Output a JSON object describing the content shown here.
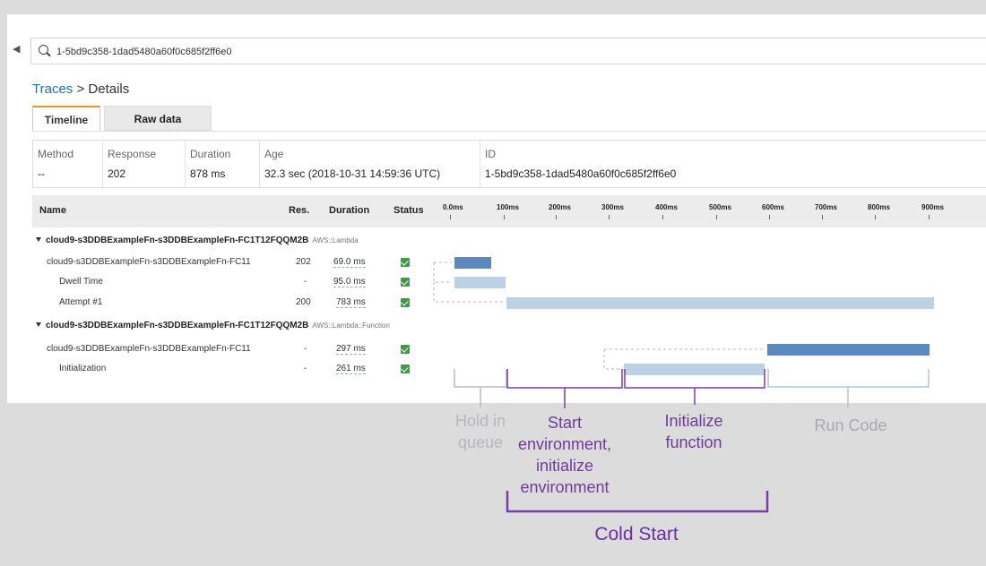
{
  "search": {
    "value": "1-5bd9c358-1dad5480a60f0c685f2ff6e0"
  },
  "breadcrumb": {
    "link": "Traces",
    "separator": ">",
    "current": "Details"
  },
  "tabs": [
    {
      "label": "Timeline",
      "active": true
    },
    {
      "label": "Raw data",
      "active": false
    }
  ],
  "summary": {
    "headers": [
      "Method",
      "Response",
      "Duration",
      "Age",
      "ID"
    ],
    "values": [
      "--",
      "202",
      "878 ms",
      "32.3 sec (2018-10-31 14:59:36 UTC)",
      "1-5bd9c358-1dad5480a60f0c685f2ff6e0"
    ]
  },
  "table": {
    "headers": {
      "name": "Name",
      "res": "Res.",
      "duration": "Duration",
      "status": "Status"
    },
    "ticks": [
      "0.0ms",
      "100ms",
      "200ms",
      "300ms",
      "400ms",
      "500ms",
      "600ms",
      "700ms",
      "800ms",
      "900ms"
    ],
    "groups": [
      {
        "name": "cloud9-s3DDBExampleFn-s3DDBExampleFn-FC1T12FQQM2B",
        "type": "AWS::Lambda",
        "rows": [
          {
            "name": "cloud9-s3DDBExampleFn-s3DDBExampleFn-FC11",
            "res": "202",
            "duration": "69.0 ms",
            "status": "ok"
          },
          {
            "name": "Dwell Time",
            "res": "-",
            "duration": "95.0 ms",
            "status": "ok"
          },
          {
            "name": "Attempt #1",
            "res": "200",
            "duration": "783 ms",
            "status": "ok"
          }
        ]
      },
      {
        "name": "cloud9-s3DDBExampleFn-s3DDBExampleFn-FC1T12FQQM2B",
        "type": "AWS::Lambda::Function",
        "rows": [
          {
            "name": "cloud9-s3DDBExampleFn-s3DDBExampleFn-FC11",
            "res": "-",
            "duration": "297 ms",
            "status": "ok"
          },
          {
            "name": "Initialization",
            "res": "-",
            "duration": "261 ms",
            "status": "ok"
          }
        ]
      }
    ]
  },
  "annotations": {
    "hold": "Hold in queue",
    "start_env": "Start environment, initialize environment",
    "init_fn": "Initialize function",
    "run_code": "Run Code",
    "cold_start": "Cold Start"
  },
  "colors": {
    "bar_dark": "#5b88bd",
    "bar_light": "#bcd1e6",
    "status_ok": "#3f9b47",
    "accent": "#7a3fa6",
    "link": "#1f6fb4"
  }
}
